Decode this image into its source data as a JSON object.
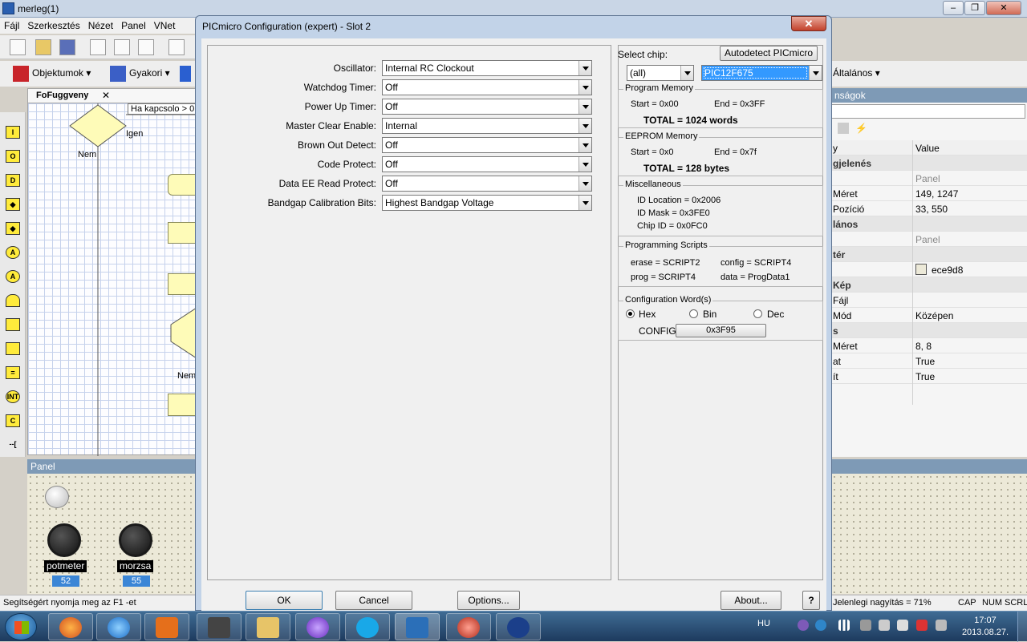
{
  "app": {
    "title": "merleg(1)",
    "menu": [
      "Fájl",
      "Szerkesztés",
      "Nézet",
      "Panel",
      "VNet"
    ],
    "toolbar2": {
      "objects": "Objektumok",
      "frequent": "Gyakori"
    },
    "right_toolbar_label": "Általános",
    "flow_tab": "FoFuggveny",
    "flow_tab_close": "✕",
    "flow_texts": {
      "decision_label": "Ha kapcsolo > 0",
      "igen": "Igen",
      "nem1": "Nem",
      "nem2": "Nem"
    },
    "panel_title": "Panel",
    "knobs": [
      {
        "label": "potmeter",
        "value": "52"
      },
      {
        "label": "morzsa",
        "value": "55"
      }
    ],
    "status_left": "Segítségért nyomja meg az F1 -et",
    "status_right": {
      "zoom": "Jelenlegi nagyítás = 71%",
      "cap": "CAP",
      "num": "NUM",
      "scrl": "SCRL"
    },
    "props": {
      "title": "nságok",
      "header_key": "y",
      "header_value": "Value",
      "rows": [
        {
          "k": "gjelenés",
          "v": "",
          "cat": true
        },
        {
          "k": "",
          "v": "Panel",
          "gray": true
        },
        {
          "k": "Méret",
          "v": "149, 1247"
        },
        {
          "k": "Pozíció",
          "v": "33, 550"
        },
        {
          "k": "lános",
          "v": "",
          "cat": true
        },
        {
          "k": "",
          "v": "Panel",
          "gray": true
        },
        {
          "k": "tér",
          "v": "",
          "cat": true
        },
        {
          "k": "",
          "v": "ece9d8",
          "color": "#ece9d8"
        },
        {
          "k": "Kép",
          "v": "",
          "cat": true
        },
        {
          "k": "Fájl",
          "v": ""
        },
        {
          "k": "Mód",
          "v": "Középen"
        },
        {
          "k": "s",
          "v": "",
          "cat": true
        },
        {
          "k": "Méret",
          "v": "8, 8"
        },
        {
          "k": "at",
          "v": "True"
        },
        {
          "k": "ít",
          "v": "True"
        }
      ]
    }
  },
  "dialog": {
    "title": "PICmicro Configuration (expert) - Slot 2",
    "close": "✕",
    "config_rows": [
      {
        "label": "Oscillator:",
        "value": "Internal RC Clockout"
      },
      {
        "label": "Watchdog Timer:",
        "value": "Off"
      },
      {
        "label": "Power Up Timer:",
        "value": "Off"
      },
      {
        "label": "Master Clear Enable:",
        "value": "Internal"
      },
      {
        "label": "Brown Out Detect:",
        "value": "Off"
      },
      {
        "label": "Code Protect:",
        "value": "Off"
      },
      {
        "label": "Data EE Read Protect:",
        "value": "Off"
      },
      {
        "label": "Bandgap Calibration Bits:",
        "value": "Highest Bandgap Voltage"
      }
    ],
    "select_chip_label": "Select chip:",
    "autodetect": "Autodetect PICmicro",
    "chip_filter": "(all)",
    "chip": "PIC12F675",
    "program_memory": {
      "title": "Program Memory",
      "start": "Start = 0x00",
      "end": "End = 0x3FF",
      "total": "TOTAL = 1024 words"
    },
    "eeprom_memory": {
      "title": "EEPROM Memory",
      "start": "Start = 0x0",
      "end": "End = 0x7f",
      "total": "TOTAL = 128 bytes"
    },
    "misc": {
      "title": "Miscellaneous",
      "id_location": "ID Location = 0x2006",
      "id_mask": "ID Mask = 0x3FE0",
      "chip_id": "Chip ID = 0x0FC0"
    },
    "scripts": {
      "title": "Programming Scripts",
      "erase": "erase = SCRIPT2",
      "config": "config = SCRIPT4",
      "prog": "prog = SCRIPT4",
      "data": "data = ProgData1"
    },
    "config_words": {
      "title": "Configuration Word(s)",
      "hex": "Hex",
      "bin": "Bin",
      "dec": "Dec",
      "selected": "Hex",
      "config_label": "CONFIG",
      "config_value": "0x3F95"
    },
    "buttons": {
      "ok": "OK",
      "cancel": "Cancel",
      "options": "Options...",
      "about": "About...",
      "help": "?"
    }
  },
  "taskbar": {
    "lang": "HU",
    "time": "17:07",
    "date": "2013.08.27."
  }
}
